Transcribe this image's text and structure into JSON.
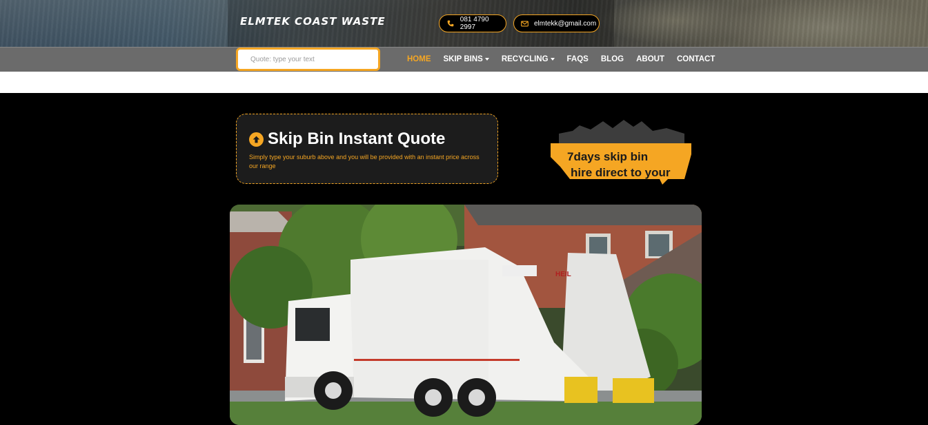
{
  "brand": {
    "name": "ELMTEK COAST WASTE"
  },
  "contact": {
    "phone": "081 4790 2997",
    "email": "elmtekk@gmail.com"
  },
  "search": {
    "placeholder": "Quote: type your text",
    "value": ""
  },
  "nav": {
    "items": [
      {
        "label": "HOME",
        "active": true,
        "dropdown": false
      },
      {
        "label": "SKIP BINS",
        "active": false,
        "dropdown": true
      },
      {
        "label": "RECYCLING",
        "active": false,
        "dropdown": true
      },
      {
        "label": "FAQS",
        "active": false,
        "dropdown": false
      },
      {
        "label": "BLOG",
        "active": false,
        "dropdown": false
      },
      {
        "label": "ABOUT",
        "active": false,
        "dropdown": false
      },
      {
        "label": "CONTACT",
        "active": false,
        "dropdown": false
      }
    ]
  },
  "quote_card": {
    "title": "Skip Bin Instant Quote",
    "description": "Simply type your suburb above and you will be provided with an instant price across our range",
    "icon": "arrow-up-circle-icon"
  },
  "promo": {
    "line1": "7days skip bin",
    "line2": "hire direct to your"
  },
  "hero": {
    "truck_badge": "HEIL"
  },
  "colors": {
    "accent": "#f5a623",
    "nav_bg": "#6b6b6b",
    "page_bg": "#000000",
    "card_bg": "#1c1c1c"
  }
}
